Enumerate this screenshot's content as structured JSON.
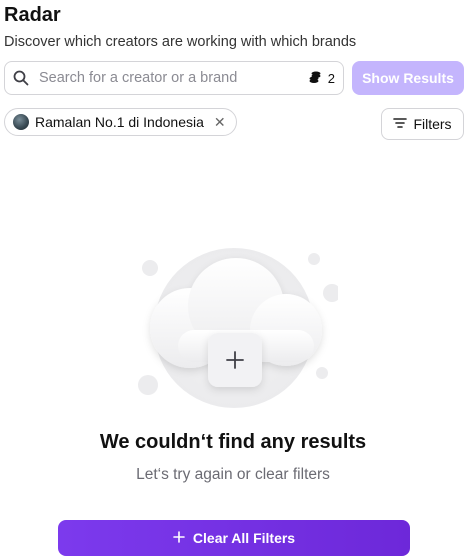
{
  "header": {
    "title": "Radar",
    "subtitle": "Discover which creators are working with which brands"
  },
  "search": {
    "placeholder": "Search for a creator or a brand",
    "value": "",
    "credits_count": "2",
    "credits_icon": "coins-icon"
  },
  "show_results_button": {
    "label": "Show Results",
    "color": "#c4b5fd"
  },
  "active_filter_chip": {
    "label": "Ramalan No.1 di Indonesia"
  },
  "filters_button": {
    "label": "Filters"
  },
  "empty_state": {
    "title": "We couldn‘t find any results",
    "subtitle": "Let‘s try again or clear filters",
    "icon": "cloud-plus-icon"
  },
  "clear_button": {
    "label": "Clear All Filters",
    "color": "#7c3aed"
  }
}
